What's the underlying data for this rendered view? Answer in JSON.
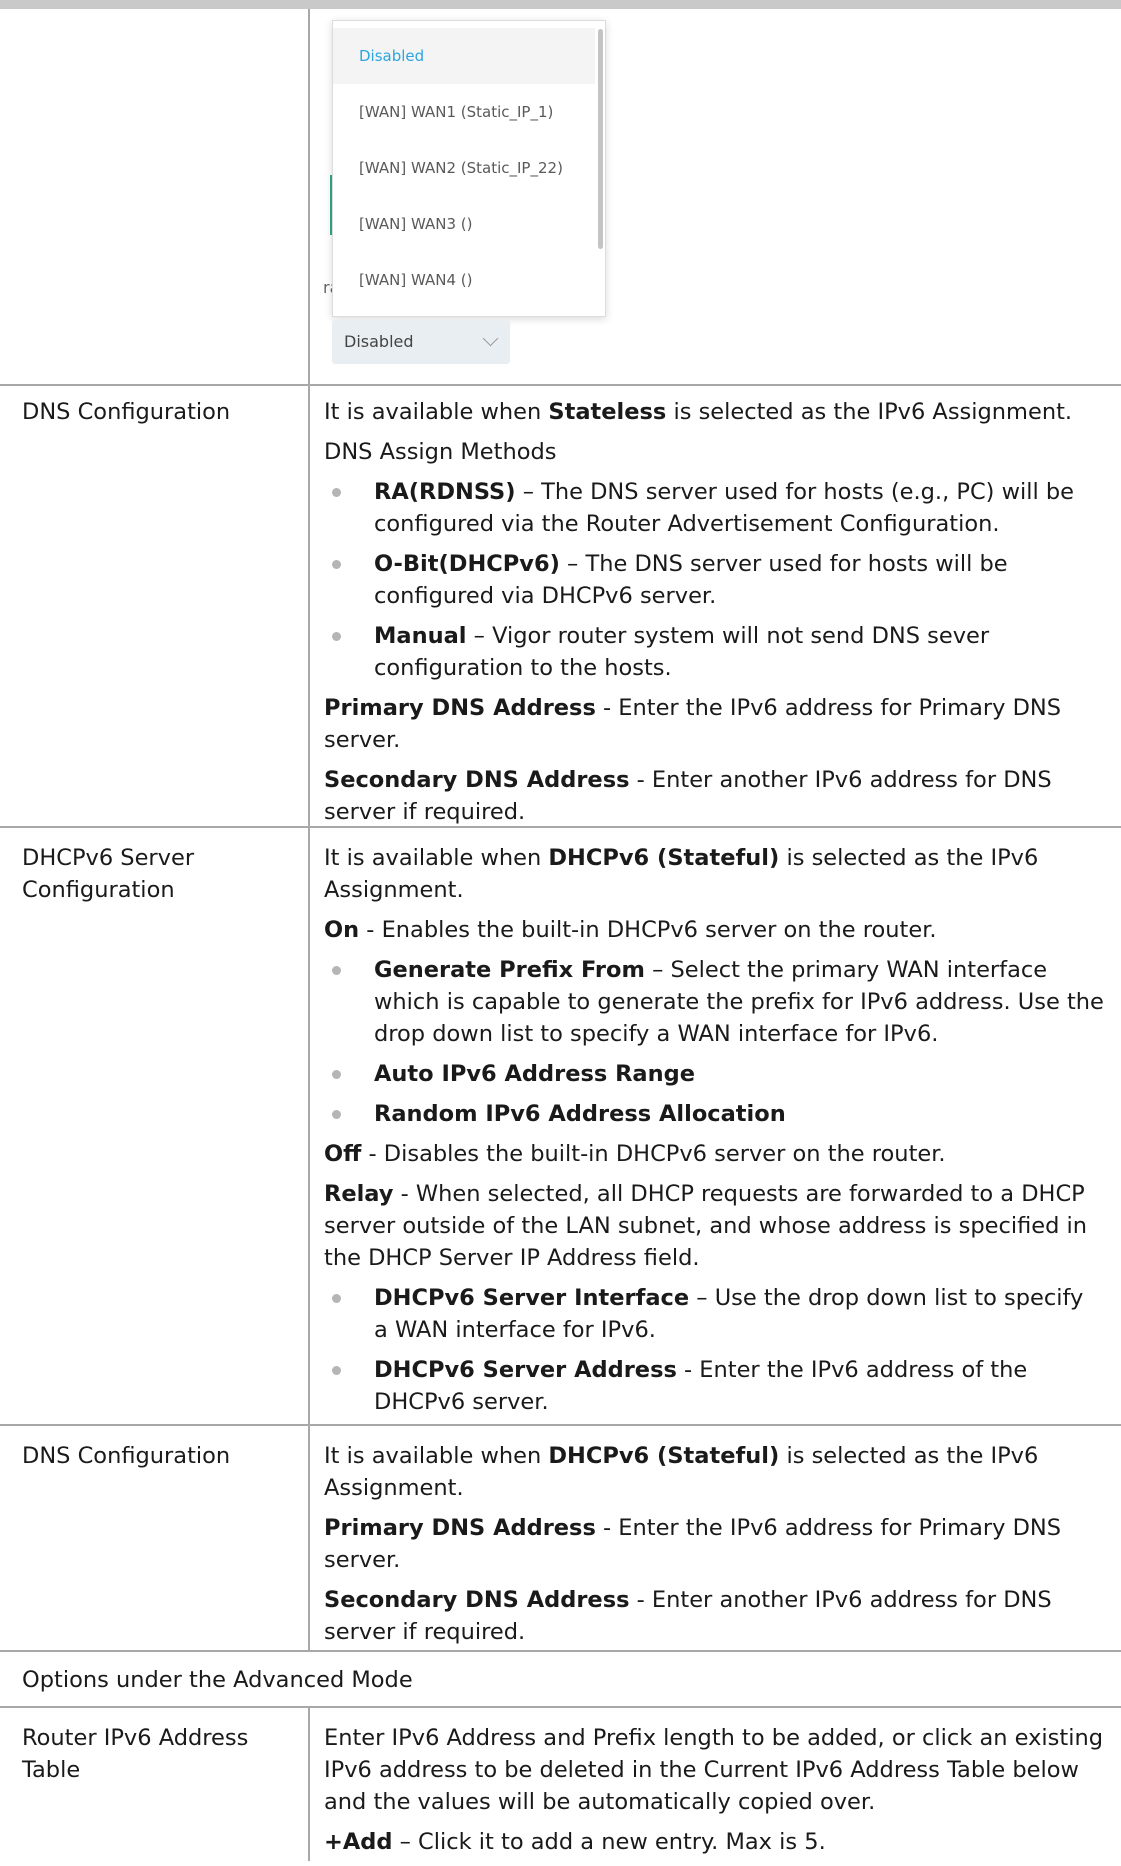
{
  "widget": {
    "options": [
      "Disabled",
      "[WAN] WAN1 (Static_IP_1)",
      "[WAN] WAN2 (Static_IP_22)",
      "[WAN] WAN3 ()",
      "[WAN] WAN4 ()"
    ],
    "selected_value": "Disabled",
    "behind_fragment": "ra"
  },
  "rows": [
    {
      "label": "DNS Configuration",
      "intro_pre": "It is available when ",
      "intro_bold": "Stateless",
      "intro_post": " is selected as the IPv6 Assignment.",
      "methods_heading": "DNS Assign Methods",
      "bullets": [
        {
          "term": "RA(RDNSS)",
          "text": " – The DNS server used for hosts (e.g., PC) will be configured via the Router Advertisement Configuration."
        },
        {
          "term": "O-Bit(DHCPv6)",
          "text": " – The DNS server used for hosts will be configured via DHCPv6 server."
        },
        {
          "term": "Manual",
          "text": " – Vigor router system will not send DNS sever configuration to the hosts."
        }
      ],
      "primary_term": "Primary DNS Address",
      "primary_text": " - Enter the IPv6 address for Primary DNS server.",
      "secondary_term": "Secondary DNS Address",
      "secondary_text": " - Enter another IPv6 address for DNS server if required."
    },
    {
      "label": "DHCPv6 Server Configuration",
      "intro_pre": "It is available when ",
      "intro_bold": "DHCPv6 (Stateful)",
      "intro_post": " is selected as the IPv6 Assignment.",
      "on_term": "On",
      "on_text": " - Enables the built-in DHCPv6 server on the router.",
      "on_bullets": [
        {
          "term": "Generate Prefix From",
          "text": " – Select the primary WAN interface which is capable to generate the prefix for IPv6 address. Use the drop down list to specify a WAN interface for IPv6."
        },
        {
          "term": "Auto IPv6 Address Range",
          "text": ""
        },
        {
          "term": "Random IPv6 Address Allocation",
          "text": ""
        }
      ],
      "off_term": "Off",
      "off_text": " - Disables the built-in DHCPv6 server on the router.",
      "relay_term": "Relay",
      "relay_text": " - When selected, all DHCP requests are forwarded to a DHCP server outside of the LAN subnet, and whose address is specified in the DHCP Server IP Address field.",
      "relay_bullets": [
        {
          "term": "DHCPv6 Server Interface",
          "text": " – Use the drop down list to specify a WAN interface for IPv6."
        },
        {
          "term": "DHCPv6 Server Address",
          "text": " - Enter the IPv6 address of the DHCPv6 server."
        }
      ]
    },
    {
      "label": "DNS Configuration",
      "intro_pre": "It is available when ",
      "intro_bold": "DHCPv6 (Stateful)",
      "intro_post": " is selected as the IPv6 Assignment.",
      "primary_term": "Primary DNS Address",
      "primary_text": " - Enter the IPv6 address for Primary DNS server.",
      "secondary_term": "Secondary DNS Address",
      "secondary_text": " - Enter another IPv6 address for DNS server if required."
    }
  ],
  "section_title": "Options under the Advanced Mode",
  "advanced_rows": [
    {
      "label": "Router IPv6 Address Table",
      "text": "Enter IPv6 Address and Prefix length to be added, or click an existing IPv6 address to be deleted in the Current IPv6 Address Table below and the values will be automatically copied over.",
      "add_term": "+Add",
      "add_text": " – Click it to add a new entry. Max is 5."
    }
  ]
}
